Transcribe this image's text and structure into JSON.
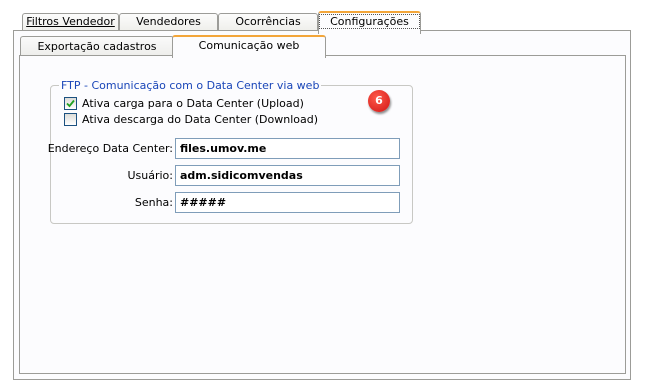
{
  "top_tabs": [
    {
      "label": "Filtros Vendedor"
    },
    {
      "label": "Vendedores"
    },
    {
      "label": "Ocorrências"
    },
    {
      "label": "Configurações"
    }
  ],
  "inner_tabs": [
    {
      "label": "Exportação cadastros"
    },
    {
      "label": "Comunicação web"
    }
  ],
  "ftp_group": {
    "title": "FTP - Comunicação com o Data Center via web",
    "upload_label": "Ativa carga para o Data Center (Upload)",
    "upload_checked": true,
    "download_label": "Ativa descarga do Data Center (Download)",
    "download_checked": false,
    "address_label": "Endereço Data Center:",
    "address_value": "files.umov.me",
    "user_label": "Usuário:",
    "user_value": "adm.sidicomvendas",
    "password_label": "Senha:",
    "password_value": "#####"
  },
  "badge": "6",
  "colors": {
    "accent": "#f3a63a",
    "group_title": "#1a46b8",
    "badge": "#d01414"
  }
}
